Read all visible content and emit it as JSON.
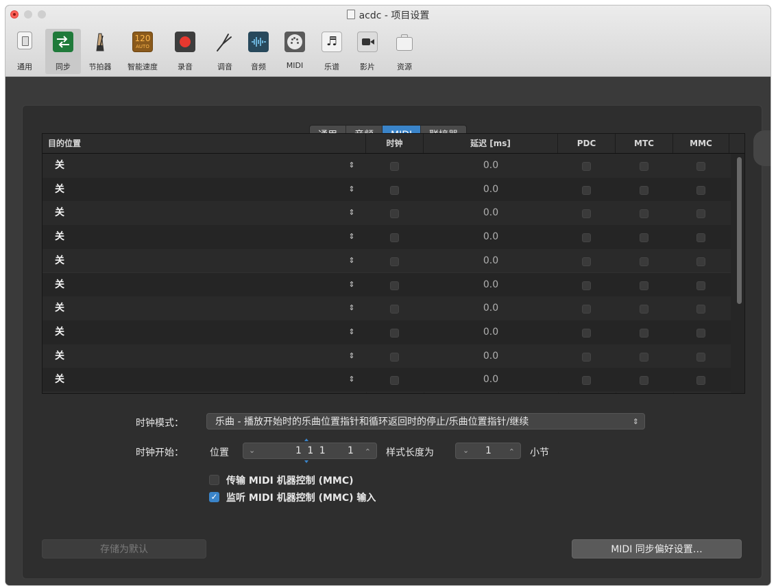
{
  "window": {
    "title": "acdc - 项目设置"
  },
  "toolbar": {
    "items": [
      {
        "label": "通用",
        "icon": "general-switch-icon"
      },
      {
        "label": "同步",
        "icon": "sync-arrows-icon",
        "selected": true
      },
      {
        "label": "节拍器",
        "icon": "metronome-icon"
      },
      {
        "label": "智能速度",
        "icon": "smart-tempo-icon",
        "badge_top": "120",
        "badge_bottom": "AUTO"
      },
      {
        "label": "录音",
        "icon": "record-icon"
      },
      {
        "label": "调音",
        "icon": "tuning-fork-icon"
      },
      {
        "label": "音频",
        "icon": "audio-waveform-icon"
      },
      {
        "label": "MIDI",
        "icon": "midi-port-icon"
      },
      {
        "label": "乐谱",
        "icon": "score-note-icon"
      },
      {
        "label": "影片",
        "icon": "movie-camera-icon"
      },
      {
        "label": "资源",
        "icon": "assets-case-icon"
      }
    ]
  },
  "tabs": [
    {
      "label": "通用"
    },
    {
      "label": "音频"
    },
    {
      "label": "MIDI",
      "active": true
    },
    {
      "label": "联接器"
    }
  ],
  "table": {
    "columns": [
      "目的位置",
      "时钟",
      "延迟 [ms]",
      "PDC",
      "MTC",
      "MMC"
    ],
    "rows": [
      {
        "dest": "关",
        "latency": "0.0"
      },
      {
        "dest": "关",
        "latency": "0.0"
      },
      {
        "dest": "关",
        "latency": "0.0"
      },
      {
        "dest": "关",
        "latency": "0.0"
      },
      {
        "dest": "关",
        "latency": "0.0"
      },
      {
        "dest": "关",
        "latency": "0.0"
      },
      {
        "dest": "关",
        "latency": "0.0"
      },
      {
        "dest": "关",
        "latency": "0.0"
      },
      {
        "dest": "关",
        "latency": "0.0"
      },
      {
        "dest": "关",
        "latency": "0.0"
      }
    ]
  },
  "clock_mode": {
    "label": "时钟模式：",
    "value": "乐曲 - 播放开始时的乐曲位置指针和循环返回时的停止/乐曲位置指针/继续"
  },
  "clock_start": {
    "label": "时钟开始：",
    "position_label": "位置",
    "position_value": "1 1 1",
    "position_tick": "1",
    "pattern_label": "样式长度为",
    "pattern_value": "1",
    "unit": "小节"
  },
  "checkboxes": [
    {
      "label": "传输 MIDI 机器控制 (MMC)",
      "checked": false
    },
    {
      "label": "监听 MIDI 机器控制 (MMC) 输入",
      "checked": true
    }
  ],
  "buttons": {
    "save_default": "存储为默认",
    "midi_prefs": "MIDI 同步偏好设置…"
  },
  "glyphs": {
    "updown": "⇕",
    "down": "⌄",
    "up": "⌃",
    "check": "✓"
  },
  "colors": {
    "accent": "#3a84c9",
    "record": "#e8382f"
  }
}
